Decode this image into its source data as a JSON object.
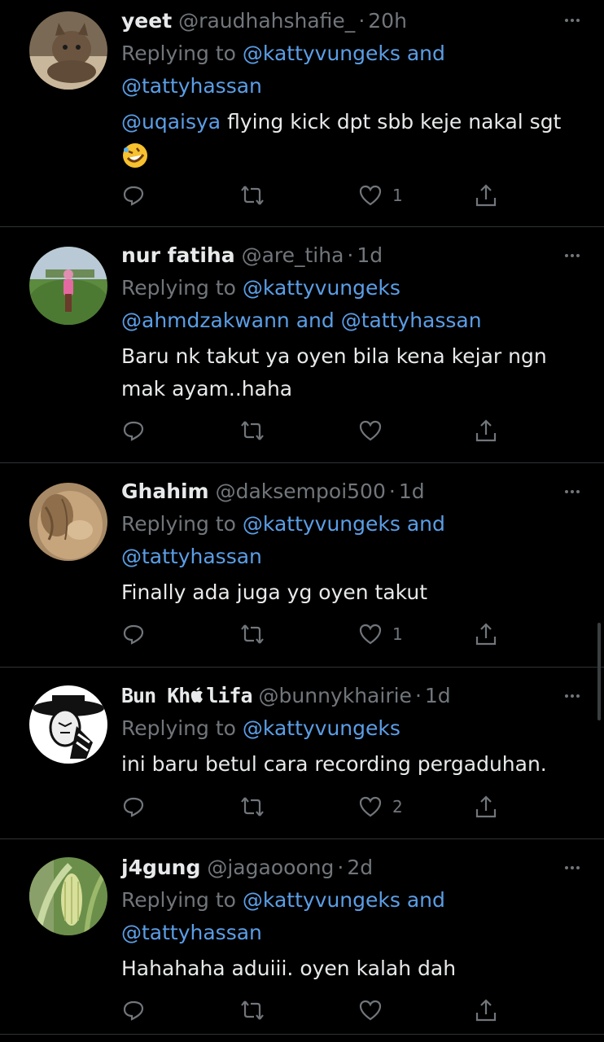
{
  "reply_prefix": "Replying to",
  "tweets": [
    {
      "name": "yeet",
      "handle": "@raudhahshafie_",
      "sep": "·",
      "time": "20h",
      "reply_a": "@kattyvungeks and",
      "reply_b": "@tattyhassan",
      "mention": "@uqaisya",
      "text": " flying kick dpt sbb keje nakal sgt",
      "likes": "1"
    },
    {
      "name": "nur fatiha",
      "handle": "@are_tiha",
      "sep": "·",
      "time": "1d",
      "reply_a": "@kattyvungeks",
      "reply_b": "@ahmdzakwann and @tattyhassan",
      "text_line1": "Baru nk takut ya oyen bila kena kejar ngn",
      "text_line2": "mak ayam..haha",
      "likes": ""
    },
    {
      "name": "Ghahim",
      "handle": "@daksempoi500",
      "sep": "·",
      "time": "1d",
      "reply_a": "@kattyvungeks and",
      "reply_b": "@tattyhassan",
      "text": "Finally ada juga yg oyen takut",
      "likes": "1"
    },
    {
      "name_a": "Bun Kh",
      "name_b": "lifa",
      "handle": "@bunnykhairie",
      "sep": "·",
      "time": "1d",
      "reply_a": "@kattyvungeks",
      "text": "ini baru betul cara recording pergaduhan.",
      "likes": "2"
    },
    {
      "name": "j4gung",
      "handle": "@jagaooong",
      "sep": "·",
      "time": "2d",
      "reply_a": "@kattyvungeks and",
      "reply_b": "@tattyhassan",
      "text": "Hahahaha aduiii. oyen kalah dah",
      "likes": ""
    }
  ],
  "icons": {
    "reply": "reply-icon",
    "retweet": "retweet-icon",
    "like": "heart-icon",
    "share": "share-icon",
    "more": "more-icon"
  },
  "colors": {
    "background": "#000000",
    "link": "#5b9ee6",
    "muted": "#71767b",
    "text": "#e7e9ea"
  }
}
